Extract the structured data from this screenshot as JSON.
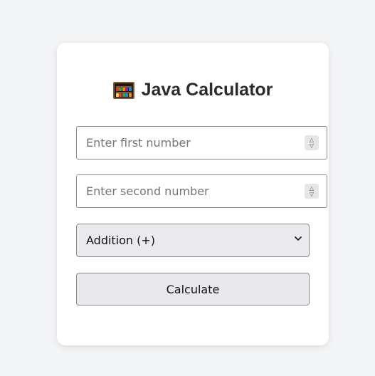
{
  "header": {
    "icon": "abacus-icon",
    "title": "Java Calculator"
  },
  "form": {
    "first_number": {
      "value": "",
      "placeholder": "Enter first number"
    },
    "second_number": {
      "value": "",
      "placeholder": "Enter second number"
    },
    "operation": {
      "selected": "Addition (+)"
    },
    "calculate_label": "Calculate"
  },
  "colors": {
    "background": "#f3f4f6",
    "card": "#ffffff",
    "title_text": "#2b2b2b",
    "button_bg": "#e9e9ed"
  }
}
